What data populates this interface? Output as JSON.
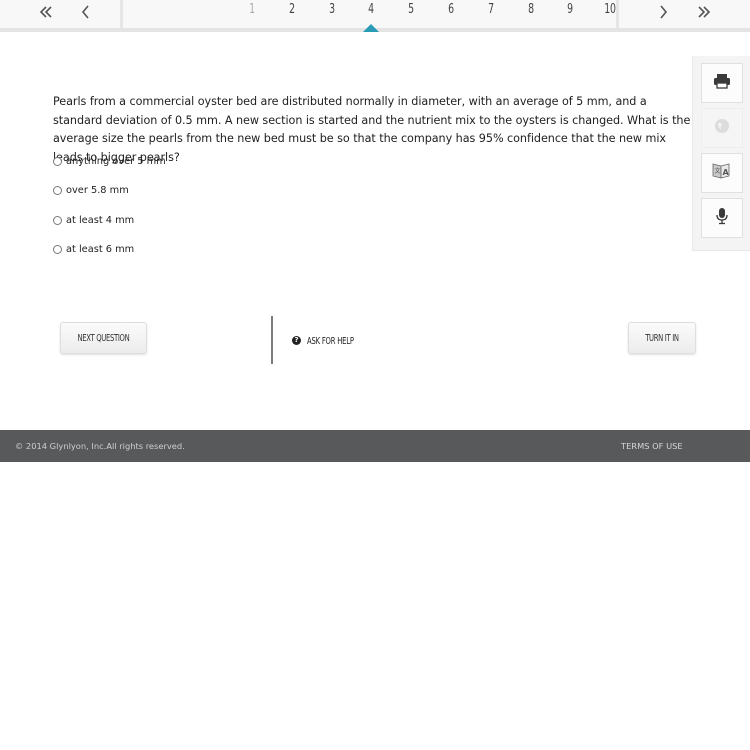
{
  "navigation": {
    "first_icon": "double-chevron-left-icon",
    "prev_icon": "chevron-left-icon",
    "next_icon": "chevron-right-icon",
    "last_icon": "double-chevron-right-icon",
    "pages": [
      "1",
      "2",
      "3",
      "4",
      "5",
      "6",
      "7",
      "8",
      "9",
      "10"
    ],
    "current_page": "4",
    "accent_color": "#2a9bb5"
  },
  "question": {
    "text": "Pearls from a commercial oyster bed are distributed normally in diameter, with an average of 5 mm, and a standard deviation of 0.5 mm. A new section is started and the nutrient mix to the oysters is changed. What is the average size the pearls from the new bed must be so that the company has 95% confidence that the new mix leads to bigger pearls?",
    "options": [
      {
        "label": "anything over 5 mm"
      },
      {
        "label": "over 5.8 mm"
      },
      {
        "label": "at least 4 mm"
      },
      {
        "label": "at least 6 mm"
      }
    ]
  },
  "tools": {
    "print_icon": "printer-icon",
    "globe_icon": "globe-icon",
    "translate_icon": "translate-icon",
    "microphone_icon": "microphone-icon"
  },
  "actions": {
    "next_question": "NEXT QUESTION",
    "ask_for_help": "ASK FOR HELP",
    "turn_it_in": "TURN IT IN"
  },
  "footer": {
    "copyright": "© 2014 Glynlyon, Inc.All rights reserved.",
    "terms": "TERMS OF USE"
  }
}
